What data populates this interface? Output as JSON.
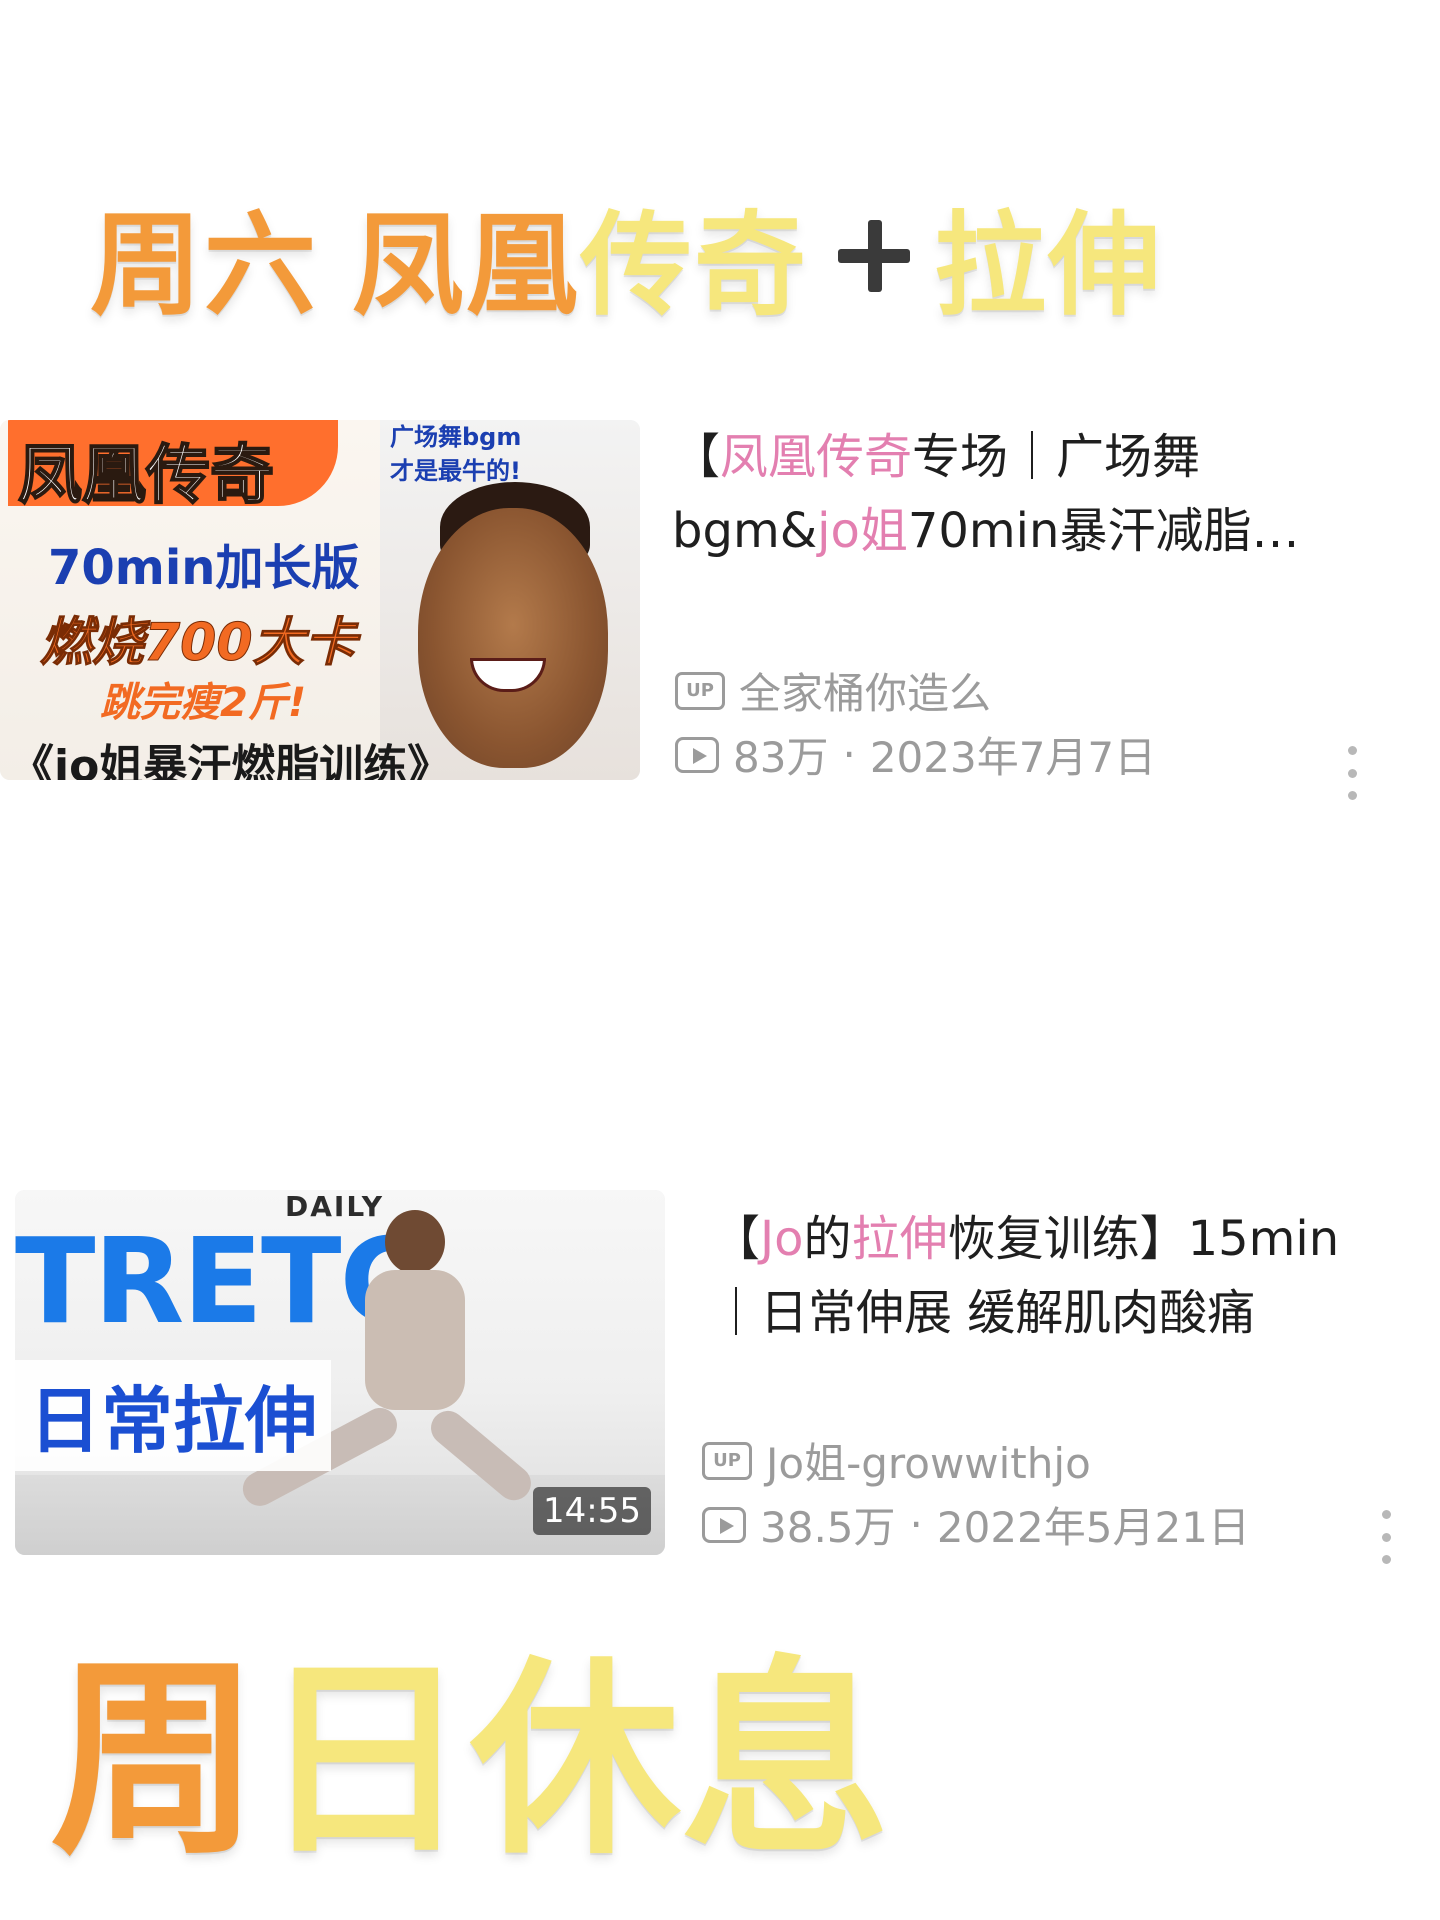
{
  "headings": {
    "saturday": {
      "day": "周六",
      "part1": "凤凰",
      "part2": "传奇",
      "part3": "拉伸",
      "plus_icon": "plus-icon"
    },
    "sunday": {
      "char1": "周",
      "char2": "日",
      "char3": "休",
      "char4": "息"
    }
  },
  "videos": [
    {
      "title_parts": {
        "p1": "【",
        "hl1": "凤凰传奇",
        "p2": "专场｜广场舞",
        "p3": "bgm&",
        "hl2": "jo姐",
        "p4": "70min暴汗减脂…"
      },
      "uploader": "全家桶你造么",
      "views": "83万",
      "date": "2023年7月7日",
      "thumbnail_text": {
        "badge": "凤凰传奇",
        "top_right_line1": "广场舞bgm",
        "top_right_line2": "才是最牛的!",
        "line1": "70min加长版",
        "line2": "燃烧700大卡",
        "line3": "跳完瘦2斤!",
        "line4": "《jo姐暴汗燃脂训练》"
      }
    },
    {
      "title_parts": {
        "p1": "【",
        "hl1": "Jo",
        "p2": "的",
        "hl2": "拉伸",
        "p3": "恢复训练】15min",
        "p4": "｜日常伸展 缓解肌肉酸痛"
      },
      "uploader": "Jo姐-growwithjo",
      "views": "38.5万",
      "date": "2022年5月21日",
      "duration": "14:55",
      "thumbnail_text": {
        "daily": "DAILY",
        "stretch": "TRETC",
        "cn": "日常拉伸"
      }
    }
  ],
  "ui": {
    "up_badge": "UP",
    "separator": "·"
  },
  "colors": {
    "heading_orange": "#F39A3A",
    "heading_yellow": "#F6E77D",
    "title_highlight": "#E37FB0",
    "meta_gray": "#9b9b9b"
  }
}
